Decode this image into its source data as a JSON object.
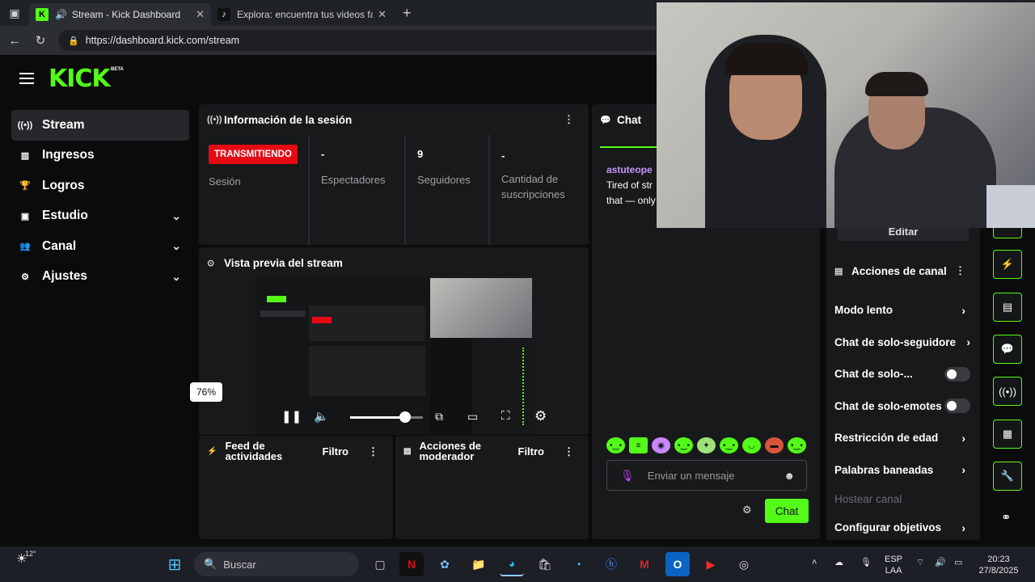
{
  "browser": {
    "tabs": [
      {
        "title": "Stream - Kick Dashboard",
        "active": true
      },
      {
        "title": "Explora: encuentra tus videos fav",
        "active": false
      }
    ],
    "url": "https://dashboard.kick.com/stream"
  },
  "sidebar": {
    "items": [
      {
        "label": "Stream",
        "icon": "stream-icon"
      },
      {
        "label": "Ingresos",
        "icon": "chart-icon"
      },
      {
        "label": "Logros",
        "icon": "trophy-icon"
      },
      {
        "label": "Estudio",
        "icon": "studio-icon"
      },
      {
        "label": "Canal",
        "icon": "users-icon"
      },
      {
        "label": "Ajustes",
        "icon": "gear-icon"
      }
    ]
  },
  "session": {
    "title": "Información de la sesión",
    "status_badge": "TRANSMITIENDO",
    "session_label": "Sesión",
    "spectators_value": "-",
    "spectators_label": "Espectadores",
    "followers_value": "9",
    "followers_label": "Seguidores",
    "subs_value": "-",
    "subs_label": "Cantidad de suscripciones"
  },
  "preview": {
    "title": "Vista previa del stream",
    "volume_percent": 76,
    "volume_tooltip": "76%"
  },
  "feed": {
    "title": "Feed de actividades",
    "filter": "Filtro"
  },
  "moderator": {
    "title": "Acciones de moderador",
    "filter": "Filtro"
  },
  "chat": {
    "title": "Chat",
    "message_user": "astuteope",
    "message_line1": "Tired of str",
    "message_line2": "that — only",
    "input_placeholder": "Enviar un mensaje",
    "send_label": "Chat"
  },
  "channel_actions": {
    "edit_label": "Editar",
    "title": "Acciones de canal",
    "items": [
      {
        "label": "Modo lento",
        "kind": "arrow"
      },
      {
        "label": "Chat de solo-seguidore",
        "kind": "arrow"
      },
      {
        "label": "Chat de solo-...",
        "kind": "toggle",
        "on": false
      },
      {
        "label": "Chat de solo-emotes",
        "kind": "toggle",
        "on": false
      },
      {
        "label": "Restricción de edad",
        "kind": "arrow"
      },
      {
        "label": "Palabras baneadas",
        "kind": "arrow"
      },
      {
        "label": "Hostear canal",
        "kind": "disabled"
      },
      {
        "label": "Configurar objetivos",
        "kind": "arrow"
      }
    ]
  },
  "taskbar": {
    "weather_temp": "12°",
    "search_placeholder": "Buscar",
    "lang_line1": "ESP",
    "lang_line2": "LAA",
    "time": "20:23",
    "date": "27/8/2025"
  },
  "colors": {
    "accent": "#53fc18",
    "live": "#e50914",
    "panel": "#18191b"
  }
}
